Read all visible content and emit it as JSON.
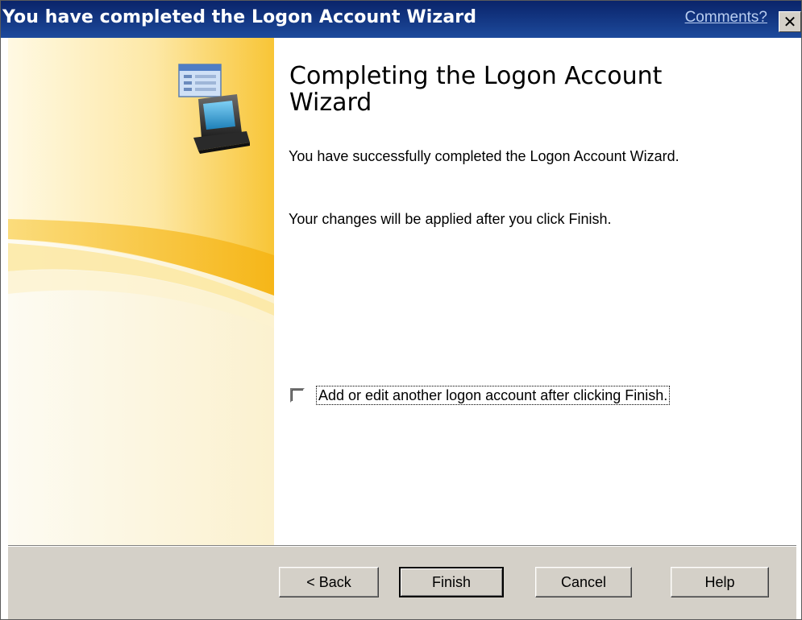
{
  "window": {
    "title": "You have completed the Logon Account Wizard",
    "comments_link": "Comments?",
    "close_glyph": "✕"
  },
  "main": {
    "heading": "Completing the Logon Account Wizard",
    "paragraph1": "You have successfully completed the Logon Account Wizard.",
    "paragraph2": "Your changes will be applied after you click Finish.",
    "checkbox": {
      "label": "Add or edit another logon account after clicking Finish.",
      "checked": false
    }
  },
  "buttons": {
    "back": "< Back",
    "finish": "Finish",
    "cancel": "Cancel",
    "help": "Help"
  },
  "icons": {
    "wizard_icon": "computer-with-window-icon"
  },
  "colors": {
    "titlebar": "#0a246a",
    "accent_yellow": "#f7c12e",
    "dialog_gray": "#d4d0c8"
  }
}
